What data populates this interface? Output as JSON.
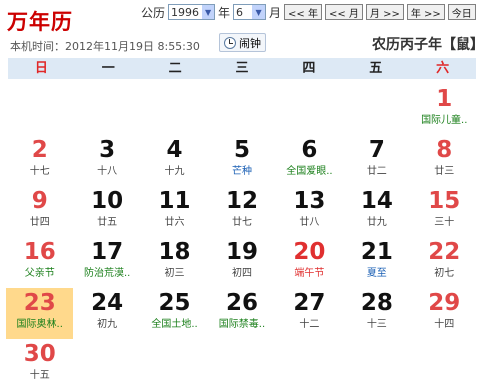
{
  "header": {
    "title": "万年历",
    "gongli_label": "公历",
    "year_value": "1996",
    "year_label": "年",
    "month_value": "6",
    "month_label": "月",
    "buttons": [
      "<< 年",
      "<< 月",
      "月 >>",
      "年 >>",
      "今日"
    ]
  },
  "now_text": "本机时间：2012年11月19日 8:55:30",
  "alarm_label": "闹钟",
  "lunar_year": "农历丙子年【鼠】",
  "weekdays": [
    "日",
    "一",
    "二",
    "三",
    "四",
    "五",
    "六"
  ],
  "calendar": [
    [
      {
        "day": "",
        "sub": ""
      },
      {
        "day": "",
        "sub": ""
      },
      {
        "day": "",
        "sub": ""
      },
      {
        "day": "",
        "sub": ""
      },
      {
        "day": "",
        "sub": ""
      },
      {
        "day": "",
        "sub": ""
      },
      {
        "day": "1",
        "sub": "国际儿童..",
        "sub_type": "fest"
      }
    ],
    [
      {
        "day": "2",
        "sub": "十七"
      },
      {
        "day": "3",
        "sub": "十八"
      },
      {
        "day": "4",
        "sub": "十九"
      },
      {
        "day": "5",
        "sub": "芒种",
        "sub_type": "term"
      },
      {
        "day": "6",
        "sub": "全国爱眼..",
        "sub_type": "fest"
      },
      {
        "day": "7",
        "sub": "廿二"
      },
      {
        "day": "8",
        "sub": "廿三"
      }
    ],
    [
      {
        "day": "9",
        "sub": "廿四"
      },
      {
        "day": "10",
        "sub": "廿五"
      },
      {
        "day": "11",
        "sub": "廿六"
      },
      {
        "day": "12",
        "sub": "廿七"
      },
      {
        "day": "13",
        "sub": "廿八"
      },
      {
        "day": "14",
        "sub": "廿九"
      },
      {
        "day": "15",
        "sub": "三十"
      }
    ],
    [
      {
        "day": "16",
        "sub": "父亲节",
        "sub_type": "fest"
      },
      {
        "day": "17",
        "sub": "防治荒漠..",
        "sub_type": "fest"
      },
      {
        "day": "18",
        "sub": "初三"
      },
      {
        "day": "19",
        "sub": "初四"
      },
      {
        "day": "20",
        "sub": "端午节",
        "sub_type": "red",
        "day_red": true
      },
      {
        "day": "21",
        "sub": "夏至",
        "sub_type": "term"
      },
      {
        "day": "22",
        "sub": "初七"
      }
    ],
    [
      {
        "day": "23",
        "sub": "国际奥林..",
        "sub_type": "fest",
        "today": true
      },
      {
        "day": "24",
        "sub": "初九"
      },
      {
        "day": "25",
        "sub": "全国土地..",
        "sub_type": "fest"
      },
      {
        "day": "26",
        "sub": "国际禁毒..",
        "sub_type": "fest"
      },
      {
        "day": "27",
        "sub": "十二"
      },
      {
        "day": "28",
        "sub": "十三"
      },
      {
        "day": "29",
        "sub": "十四"
      }
    ],
    [
      {
        "day": "30",
        "sub": "十五"
      },
      {
        "day": "",
        "sub": ""
      },
      {
        "day": "",
        "sub": ""
      },
      {
        "day": "",
        "sub": ""
      },
      {
        "day": "",
        "sub": ""
      },
      {
        "day": "",
        "sub": ""
      },
      {
        "day": "",
        "sub": ""
      }
    ]
  ],
  "colors": {
    "weekend": "#e04848",
    "festival": "#1a7f1a",
    "solar_term": "#1a5fb4",
    "today_bg": "#ffd98c",
    "title": "#cc0000"
  }
}
